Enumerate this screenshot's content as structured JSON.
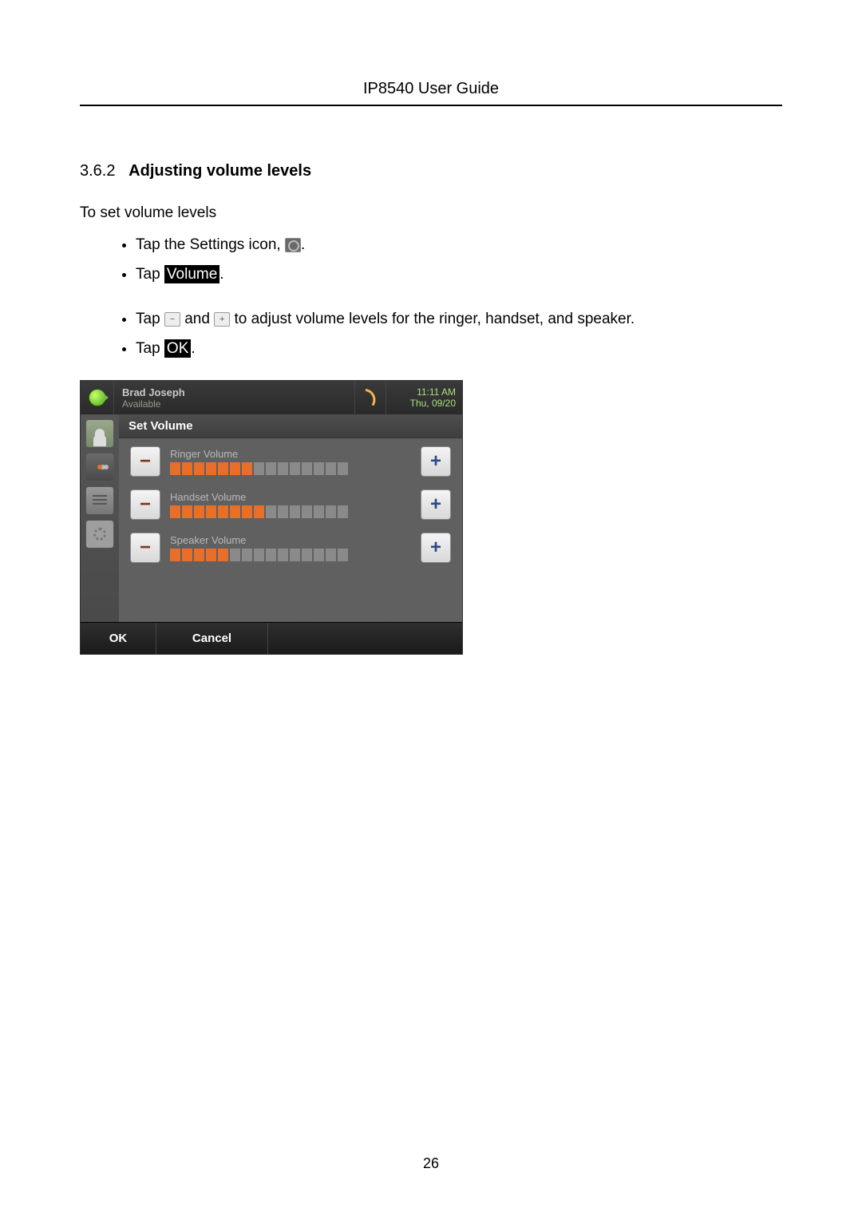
{
  "header": {
    "title": "IP8540 User Guide"
  },
  "section": {
    "number": "3.6.2",
    "title": "Adjusting volume levels"
  },
  "intro": "To set volume levels",
  "steps": {
    "s1a": "Tap the Settings icon, ",
    "s1b": ".",
    "s2a": "Tap ",
    "s2hl": "Volume",
    "s2b": ".",
    "s3a": "Tap ",
    "s3b": " and ",
    "s3c": " to adjust volume levels for the ringer, handset, and speaker.",
    "s4a": "Tap ",
    "s4hl": "OK",
    "s4b": "."
  },
  "inline": {
    "minus": "−",
    "plus": "+"
  },
  "screenshot": {
    "user_name": "Brad Joseph",
    "user_status": "Available",
    "time": "11:11 AM",
    "date": "Thu, 09/20",
    "panel_title": "Set Volume",
    "ringer_label": "Ringer Volume",
    "handset_label": "Handset Volume",
    "speaker_label": "Speaker Volume",
    "minus": "−",
    "plus": "+",
    "ok": "OK",
    "cancel": "Cancel"
  },
  "chart_data": {
    "type": "bar",
    "title": "Set Volume",
    "series": [
      {
        "name": "Ringer Volume",
        "value": 7,
        "max": 15
      },
      {
        "name": "Handset Volume",
        "value": 8,
        "max": 15
      },
      {
        "name": "Speaker Volume",
        "value": 5,
        "max": 15
      }
    ]
  },
  "page_number": "26"
}
